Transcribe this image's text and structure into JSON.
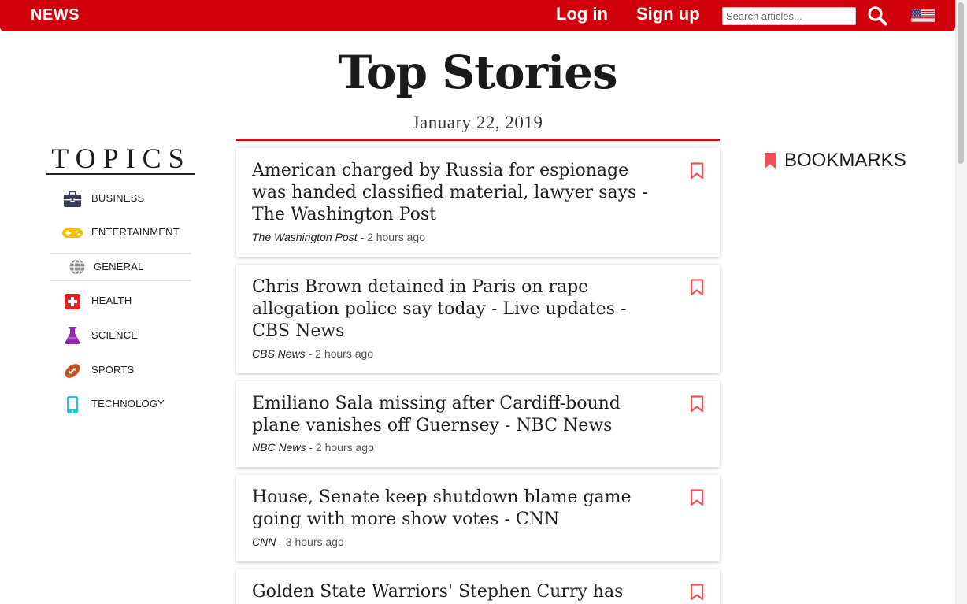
{
  "navbar": {
    "brand": "NEWS",
    "login": "Log in",
    "signup": "Sign up",
    "search_placeholder": "Search articles...",
    "search_icon": "search-icon",
    "flag_icon": "us-flag-icon",
    "brand_color": "#d0000c"
  },
  "header": {
    "title": "Top Stories",
    "date": "January 22, 2019",
    "accent_color": "#c8101a"
  },
  "topics": {
    "heading": "TOPICS",
    "items": [
      {
        "label": "BUSINESS",
        "icon": "briefcase-icon",
        "color": "#3b3f5c"
      },
      {
        "label": "ENTERTAINMENT",
        "icon": "gamepad-icon",
        "color": "#f2c200"
      },
      {
        "label": "GENERAL",
        "icon": "globe-icon",
        "color": "#8a8a8a",
        "active": true
      },
      {
        "label": "HEALTH",
        "icon": "medical-cross-icon",
        "color": "#e0222b"
      },
      {
        "label": "SCIENCE",
        "icon": "flask-icon",
        "color": "#8e2aa6"
      },
      {
        "label": "SPORTS",
        "icon": "football-icon",
        "color": "#c0541f"
      },
      {
        "label": "TECHNOLOGY",
        "icon": "smartphone-icon",
        "color": "#1fc7c7"
      }
    ]
  },
  "articles": [
    {
      "title": "American charged by Russia for espionage was handed classified material, lawyer says - The Washington Post",
      "source": "The Washington Post",
      "time": "2 hours ago"
    },
    {
      "title": "Chris Brown detained in Paris on rape allegation police say today - Live updates - CBS News",
      "source": "CBS News",
      "time": "2 hours ago"
    },
    {
      "title": "Emiliano Sala missing after Cardiff-bound plane vanishes off Guernsey - NBC News",
      "source": "NBC News",
      "time": "2 hours ago"
    },
    {
      "title": "House, Senate keep shutdown blame game going with more show votes - CNN",
      "source": "CNN",
      "time": "3 hours ago"
    },
    {
      "title": "Golden State Warriors' Stephen Curry has",
      "source": "",
      "time": ""
    }
  ],
  "meta_separator": " - ",
  "bookmarks": {
    "label": "BOOKMARKS",
    "icon": "bookmark-icon",
    "color": "#f0505a"
  }
}
